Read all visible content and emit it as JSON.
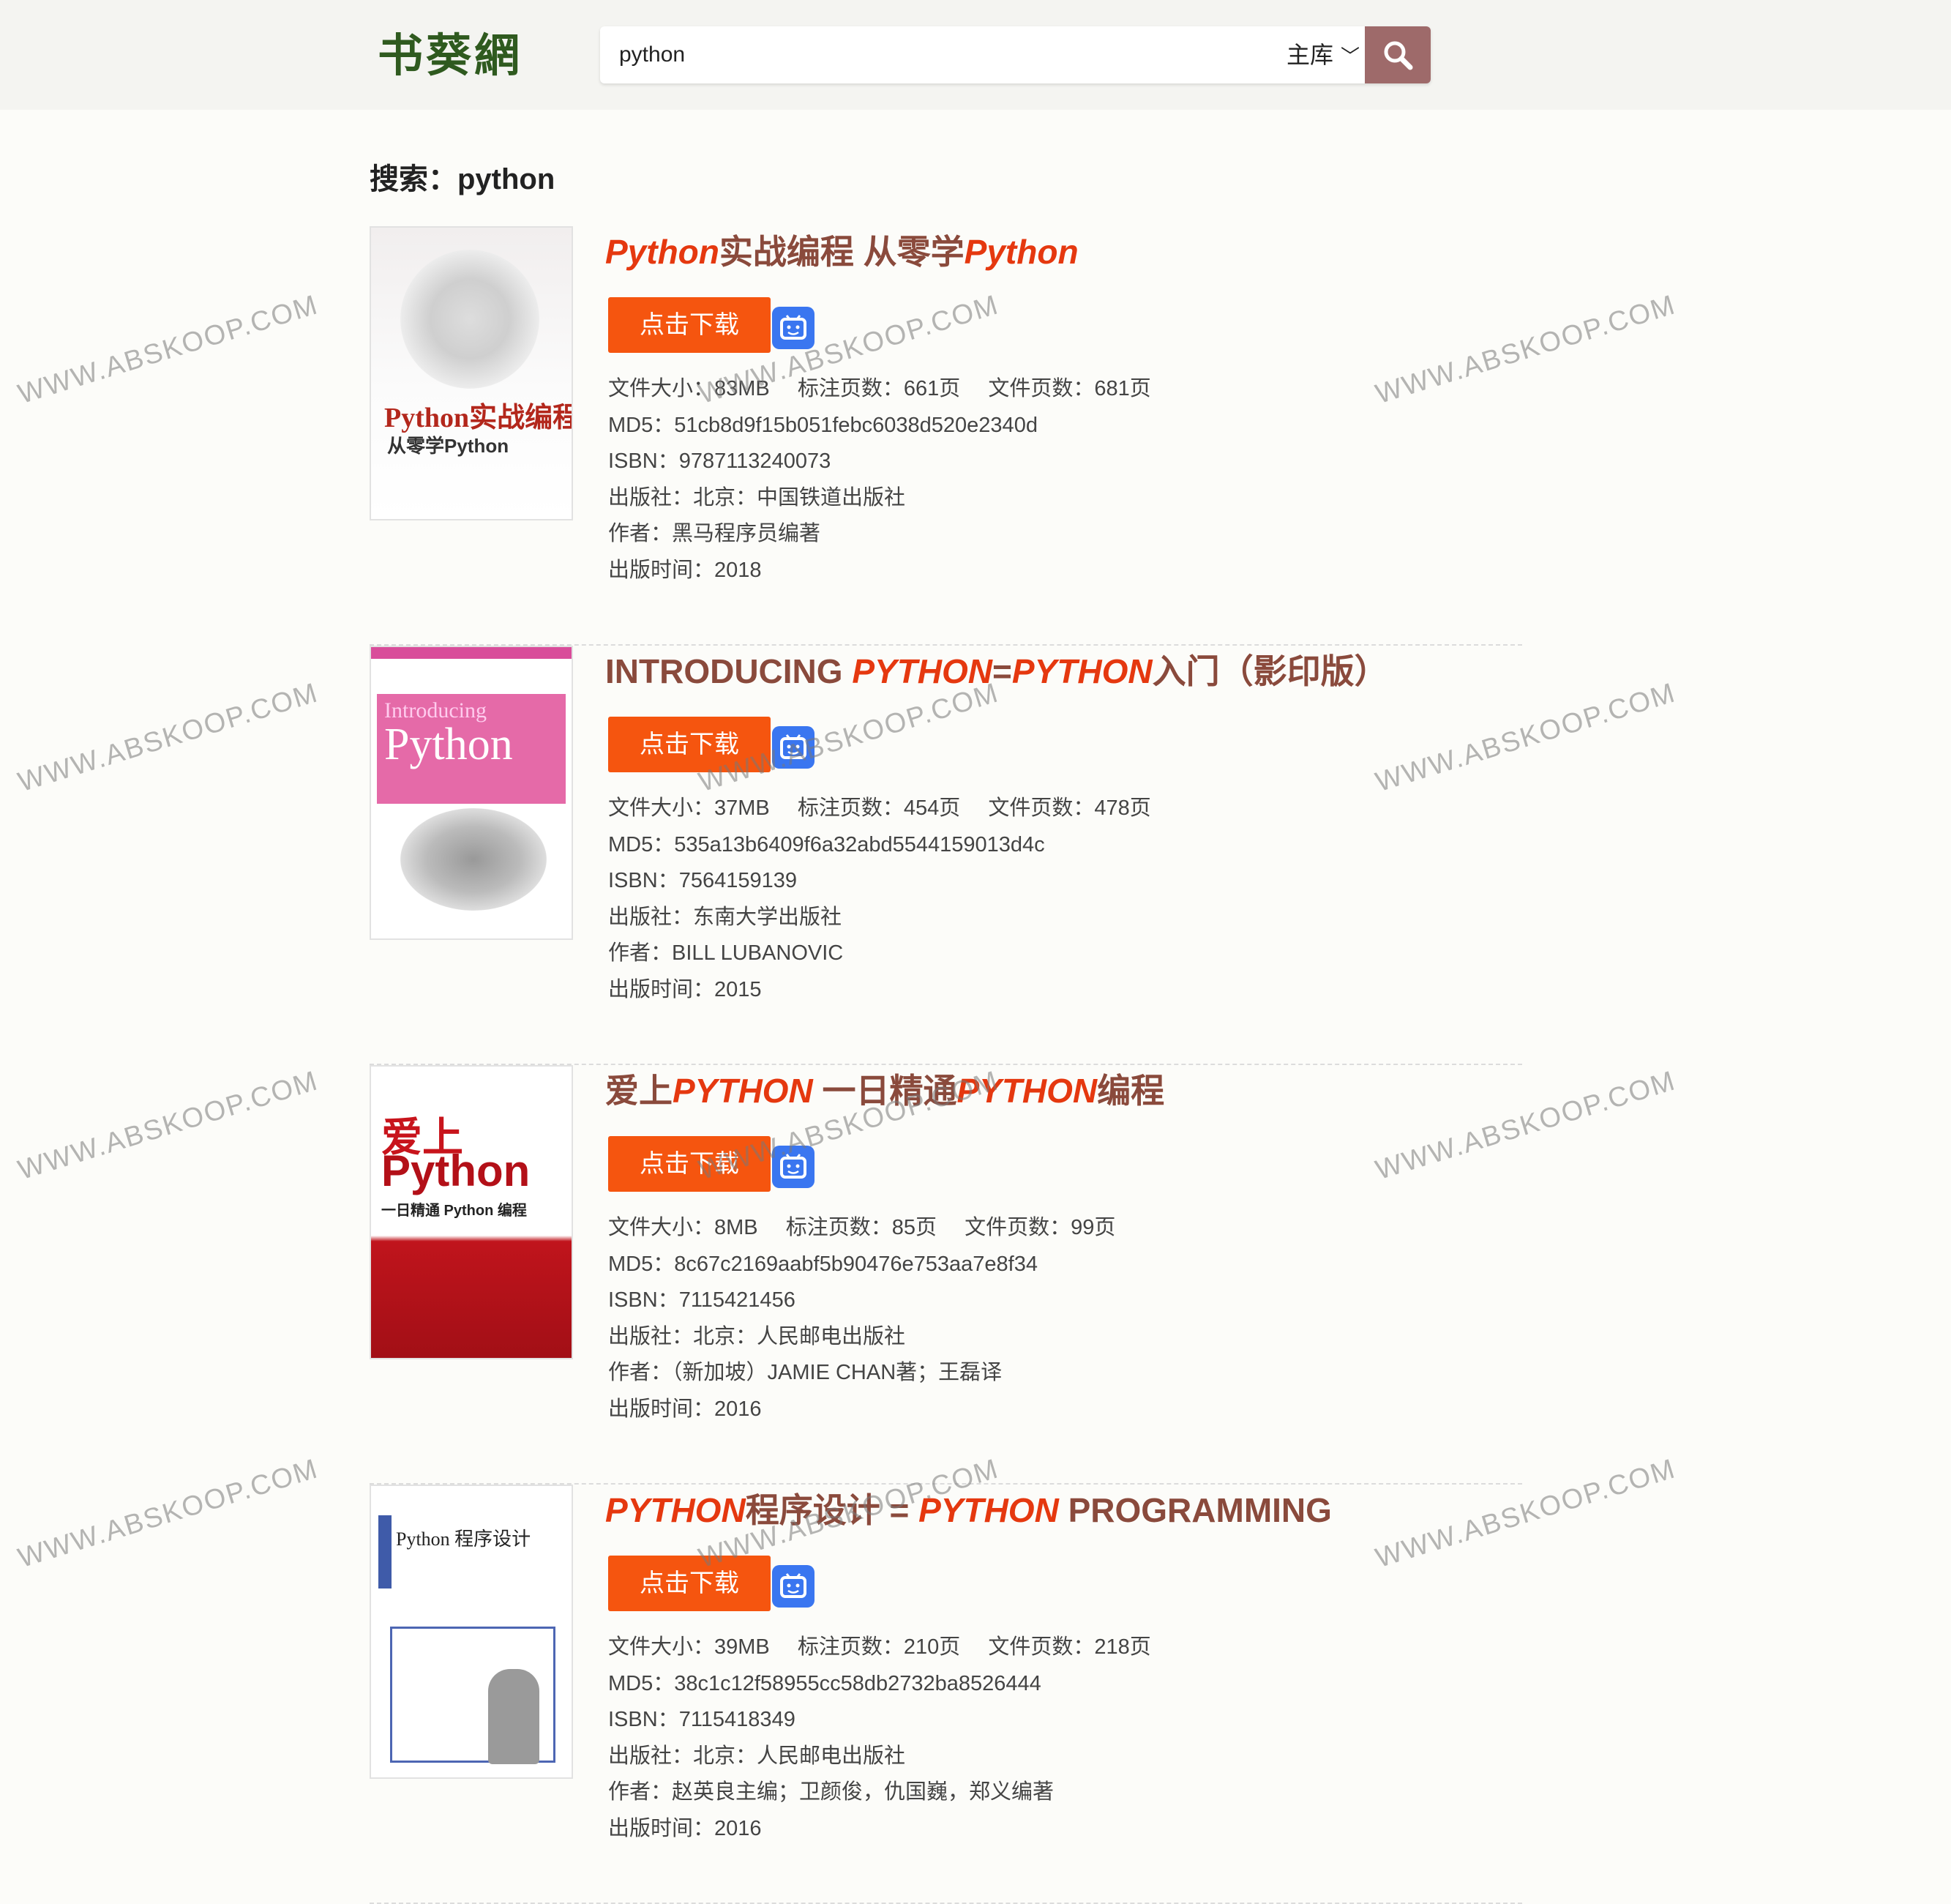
{
  "header": {
    "logo": "书葵網",
    "search_value": "python",
    "library": "主库"
  },
  "page": {
    "heading_prefix": "搜索：",
    "heading_query": "python"
  },
  "download_label": "点击下载",
  "labels": {
    "size": "文件大小：",
    "marked_pages": "标注页数：",
    "file_pages": "文件页数：",
    "md5": "MD5：",
    "isbn": "ISBN：",
    "publisher": "出版社：",
    "author": "作者：",
    "pub_time": "出版时间："
  },
  "results": [
    {
      "title_parts": [
        [
          "Python",
          true
        ],
        [
          "实战编程 从零学",
          false
        ],
        [
          "Python",
          true
        ]
      ],
      "size": "83MB",
      "marked_pages": "661页",
      "file_pages": "681页",
      "md5": "51cb8d9f15b051febc6038d520e2340d",
      "isbn": "9787113240073",
      "publisher": "北京：中国铁道出版社",
      "author": "黑马程序员编著",
      "pub_time": "2018",
      "cover": {
        "title": "Python实战编程:",
        "subtitle": "从零学Python"
      }
    },
    {
      "title_parts": [
        [
          "INTRODUCING ",
          false
        ],
        [
          "PYTHON",
          true
        ],
        [
          "=",
          false
        ],
        [
          "PYTHON",
          true
        ],
        [
          "入门（影印版）",
          false
        ]
      ],
      "size": "37MB",
      "marked_pages": "454页",
      "file_pages": "478页",
      "md5": "535a13b6409f6a32abd5544159013d4c",
      "isbn": "7564159139",
      "publisher": "东南大学出版社",
      "author": "BILL LUBANOVIC",
      "pub_time": "2015",
      "cover": {
        "title": "Introducing",
        "subtitle": "Python"
      }
    },
    {
      "title_parts": [
        [
          "爱上",
          false
        ],
        [
          "PYTHON",
          true
        ],
        [
          " 一日精通",
          false
        ],
        [
          "PYTHON",
          true
        ],
        [
          "编程",
          false
        ]
      ],
      "size": "8MB",
      "marked_pages": "85页",
      "file_pages": "99页",
      "md5": "8c67c2169aabf5b90476e753aa7e8f34",
      "isbn": "7115421456",
      "publisher": "北京：人民邮电出版社",
      "author": "（新加坡）JAMIE CHAN著；王磊译",
      "pub_time": "2016",
      "cover": {
        "title": "爱上",
        "subtitle": "Python",
        "tag": "一日精通 Python 编程"
      }
    },
    {
      "title_parts": [
        [
          "PYTHON",
          true
        ],
        [
          "程序设计 = ",
          false
        ],
        [
          "PYTHON",
          true
        ],
        [
          " PROGRAMMING",
          false
        ]
      ],
      "size": "39MB",
      "marked_pages": "210页",
      "file_pages": "218页",
      "md5": "38c1c12f58955cc58db2732ba8526444",
      "isbn": "7115418349",
      "publisher": "北京：人民邮电出版社",
      "author": "赵英良主编；卫颜俊，仇国巍，郑义编著",
      "pub_time": "2016",
      "cover": {
        "title": "Python 程序设计"
      }
    }
  ],
  "watermark": "WWW.ABSKOOP.COM",
  "colors": {
    "accent": "#f5550f",
    "title": "#8a4a3c",
    "highlight": "#e5380f",
    "logo": "#2f5a1f",
    "search_button": "#9e6a6a"
  }
}
